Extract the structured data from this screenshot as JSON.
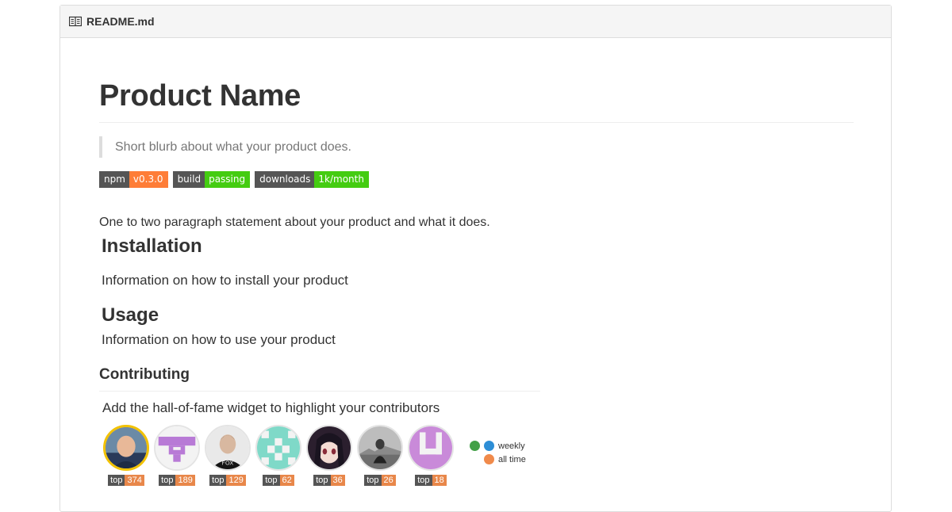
{
  "header": {
    "filename": "README.md",
    "icon": "book-icon"
  },
  "readme": {
    "title": "Product Name",
    "blurb": "Short blurb about what your product does.",
    "badges": [
      {
        "label": "npm",
        "value": "v0.3.0",
        "color": "#fe7d37"
      },
      {
        "label": "build",
        "value": "passing",
        "color": "#4c1"
      },
      {
        "label": "downloads",
        "value": "1k/month",
        "color": "#4c1"
      }
    ],
    "intro": "One to two paragraph statement about your product and what it does.",
    "installation": {
      "heading": "Installation",
      "text": "Information on how to install your product"
    },
    "usage": {
      "heading": "Usage",
      "text": "Information on how to use your product"
    },
    "contributing": {
      "heading": "Contributing",
      "text": "Add the hall-of-fame widget to highlight your contributors"
    }
  },
  "hall_of_fame": {
    "contributors": [
      {
        "rank_label": "top",
        "rank": "374"
      },
      {
        "rank_label": "top",
        "rank": "189"
      },
      {
        "rank_label": "top",
        "rank": "129"
      },
      {
        "rank_label": "top",
        "rank": "62"
      },
      {
        "rank_label": "top",
        "rank": "36"
      },
      {
        "rank_label": "top",
        "rank": "26"
      },
      {
        "rank_label": "top",
        "rank": "18"
      }
    ],
    "legend": {
      "weekly": "weekly",
      "all_time": "all time",
      "colors": {
        "green": "#43a047",
        "blue": "#2e8ed6",
        "orange": "#f08a4b"
      }
    }
  }
}
